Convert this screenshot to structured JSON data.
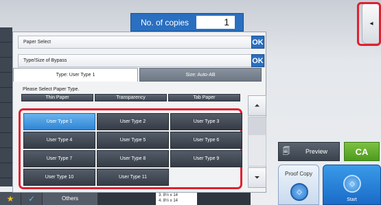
{
  "header": {
    "copies_label": "No. of copies",
    "copies_value": "1"
  },
  "panel": {
    "paper_select_label": "Paper Select",
    "ok_label": "OK",
    "bypass_label": "Type/Size of Bypass",
    "tabs": [
      {
        "label": "Type:  User Type 1",
        "active": true
      },
      {
        "label": "Size:  Auto-AB",
        "active": false
      }
    ],
    "prompt": "Please Select Paper Type.",
    "top_types": [
      "Thin Paper",
      "Transparency",
      "Tab Paper"
    ],
    "user_types": [
      {
        "label": "User Type 1",
        "selected": true
      },
      {
        "label": "User Type 2",
        "selected": false
      },
      {
        "label": "User Type 3",
        "selected": false
      },
      {
        "label": "User Type 4",
        "selected": false
      },
      {
        "label": "User Type 5",
        "selected": false
      },
      {
        "label": "User Type 6",
        "selected": false
      },
      {
        "label": "User Type 7",
        "selected": false
      },
      {
        "label": "User Type 8",
        "selected": false
      },
      {
        "label": "User Type 9",
        "selected": false
      },
      {
        "label": "User Type 10",
        "selected": false
      },
      {
        "label": "User Type 11",
        "selected": false
      }
    ]
  },
  "right": {
    "preview_label": "Preview",
    "ca_label": "CA",
    "proof_copy_label": "Proof Copy",
    "start_label": "Start"
  },
  "bottom": {
    "others_label": "Others",
    "tray_line1": "3.  8½ x 14",
    "tray_line2": "4.  8½ x 14"
  },
  "icons": {
    "tab_handle": "arrow-left-icon",
    "scroll_up": "double-chevron-up-icon",
    "scroll_down": "double-chevron-down-icon",
    "favorite": "star-icon",
    "check": "check-icon",
    "start": "diamond-icon"
  },
  "colors": {
    "accent_blue": "#2a6fc0",
    "ca_green": "#5aa62a",
    "highlight_red": "#e02030",
    "selected_blue": "#3b8fdc"
  }
}
